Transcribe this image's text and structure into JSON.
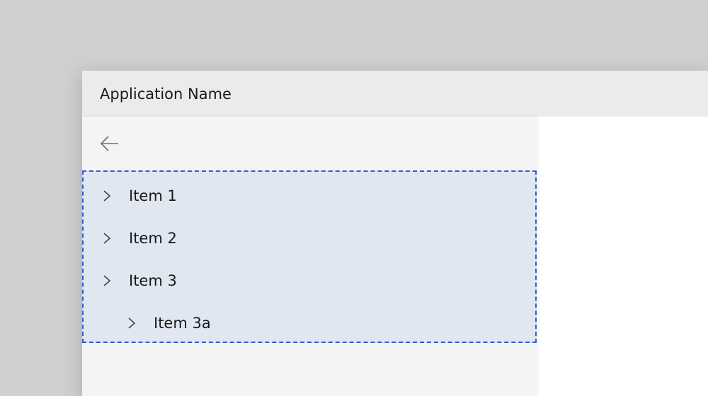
{
  "header": {
    "title": "Application Name"
  },
  "nav": {
    "items": [
      {
        "label": "Item 1"
      },
      {
        "label": "Item 2"
      },
      {
        "label": "Item 3",
        "children": [
          {
            "label": "Item 3a"
          }
        ]
      }
    ]
  },
  "colors": {
    "highlight_border": "#2b5fcc",
    "highlight_fill": "rgba(60,120,220,0.10)"
  }
}
